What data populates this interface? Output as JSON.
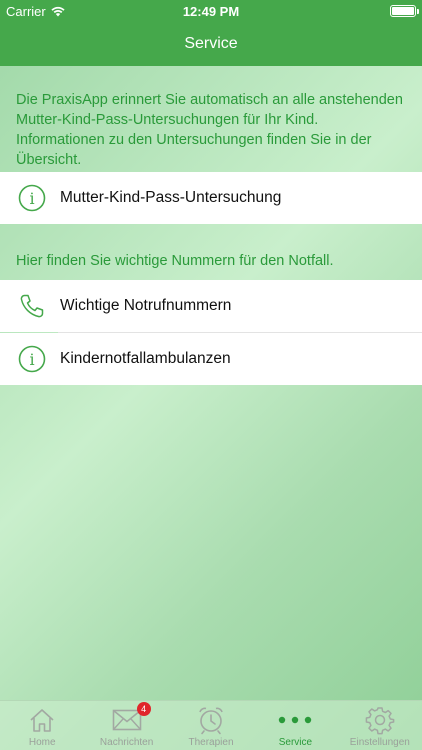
{
  "status_bar": {
    "carrier": "Carrier",
    "time": "12:49 PM"
  },
  "nav": {
    "title": "Service"
  },
  "intro_text": "Die PraxisApp erinnert Sie automatisch an alle anstehenden Mutter-Kind-Pass-Untersuchungen für Ihr Kind. Informationen zu den Untersuchungen finden Sie in der Übersicht.",
  "rows_top": [
    {
      "label": "Mutter-Kind-Pass-Untersuchung",
      "icon": "info-circle-icon"
    }
  ],
  "emergency_note": "Hier finden Sie wichtige Nummern für den Notfall.",
  "rows_emergency": [
    {
      "label": "Wichtige Notrufnummern",
      "icon": "phone-icon"
    },
    {
      "label": "Kindernotfallambulanzen",
      "icon": "info-circle-icon"
    }
  ],
  "tabs": [
    {
      "label": "Home",
      "icon": "home-icon"
    },
    {
      "label": "Nachrichten",
      "icon": "envelope-icon",
      "badge": "4"
    },
    {
      "label": "Therapien",
      "icon": "alarm-clock-icon"
    },
    {
      "label": "Service",
      "icon": "more-dots-icon",
      "active": true
    },
    {
      "label": "Einstellungen",
      "icon": "gear-icon"
    }
  ],
  "colors": {
    "accent": "#45a84b",
    "text_green": "#2a9a3a",
    "badge": "#e0262b"
  }
}
